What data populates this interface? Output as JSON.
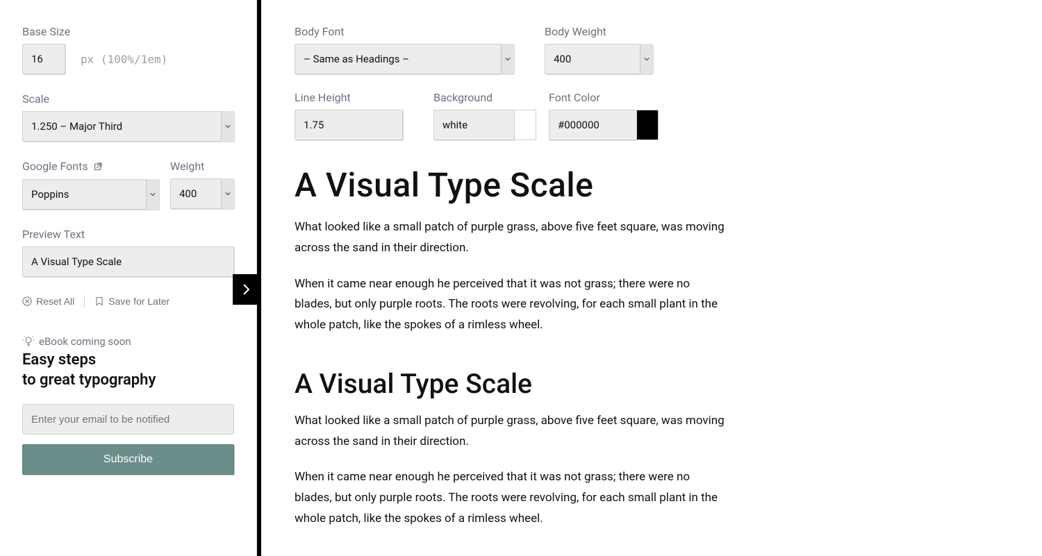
{
  "sidebar": {
    "base_size": {
      "label": "Base Size",
      "value": "16",
      "hint": "px (100%/1em)"
    },
    "scale": {
      "label": "Scale",
      "value": "1.250 – Major Third"
    },
    "google_fonts": {
      "label": "Google Fonts",
      "value": "Poppins"
    },
    "heading_weight": {
      "label": "Weight",
      "value": "400"
    },
    "preview_text": {
      "label": "Preview Text",
      "value": "A Visual Type Scale"
    },
    "actions": {
      "reset": "Reset All",
      "save": "Save for Later"
    },
    "ebook": {
      "kicker": "eBook coming soon",
      "title_line1": "Easy steps",
      "title_line2": "to great typography",
      "email_placeholder": "Enter your email to be notified",
      "subscribe": "Subscribe"
    }
  },
  "main": {
    "body_font": {
      "label": "Body Font",
      "value": "– Same as Headings –"
    },
    "body_weight": {
      "label": "Body Weight",
      "value": "400"
    },
    "line_height": {
      "label": "Line Height",
      "value": "1.75"
    },
    "background": {
      "label": "Background",
      "value": "white",
      "swatch": "#ffffff"
    },
    "font_color": {
      "label": "Font Color",
      "value": "#000000",
      "swatch": "#000000"
    },
    "preview": {
      "heading": "A Visual Type Scale",
      "p1": "What looked like a small patch of purple grass, above five feet square, was moving across the sand in their direction.",
      "p2": "When it came near enough he perceived that it was not grass; there were no blades, but only purple roots. The roots were revolving, for each small plant in the whole patch, like the spokes of a rimless wheel."
    }
  }
}
